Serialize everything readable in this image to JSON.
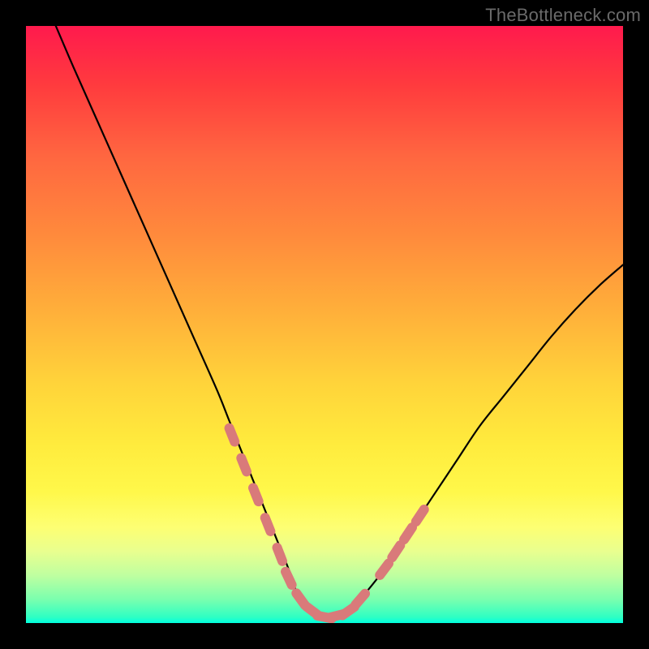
{
  "watermark": "TheBottleneck.com",
  "colors": {
    "curve_stroke": "#000000",
    "marker_fill": "#d97a7a",
    "marker_stroke": "#b55a5a",
    "frame": "#000000"
  },
  "chart_data": {
    "type": "line",
    "title": "",
    "xlabel": "",
    "ylabel": "",
    "xlim": [
      0,
      100
    ],
    "ylim": [
      0,
      100
    ],
    "note": "No numeric axis ticks are visible; x and y are normalized 0–100 from the plot area. y is the curve height above the bottom edge.",
    "series": [
      {
        "name": "curve",
        "x": [
          5,
          8,
          12,
          16,
          20,
          24,
          28,
          32,
          34,
          36,
          38,
          40,
          42,
          44,
          45,
          46,
          48,
          50,
          52,
          54,
          56,
          60,
          64,
          68,
          72,
          76,
          80,
          84,
          88,
          92,
          96,
          100
        ],
        "y": [
          100,
          93,
          84,
          75,
          66,
          57,
          48,
          39,
          34,
          29,
          24,
          19,
          14,
          9,
          6,
          4,
          2,
          1,
          1,
          2,
          4,
          9,
          15,
          21,
          27,
          33,
          38,
          43,
          48,
          52.5,
          56.5,
          60
        ]
      }
    ],
    "markers": {
      "name": "highlighted-points",
      "x": [
        34.5,
        36.5,
        38.5,
        40.5,
        42.5,
        44.0,
        46.0,
        48.0,
        50.0,
        52.0,
        54.0,
        56.0,
        60.0,
        62.0,
        64.0,
        66.0
      ],
      "y": [
        31.5,
        26.5,
        21.5,
        16.5,
        11.5,
        7.5,
        4.0,
        2.0,
        1.0,
        1.2,
        2.0,
        4.0,
        9.0,
        12.0,
        15.0,
        18.0
      ]
    }
  }
}
